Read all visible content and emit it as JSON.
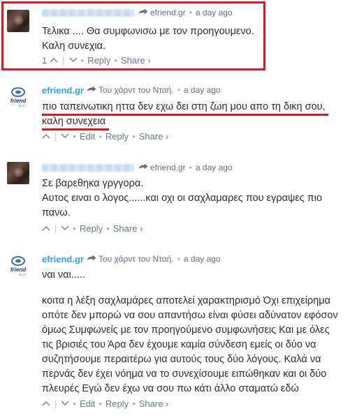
{
  "comments": [
    {
      "avatar": "avatar-photo",
      "reply_to": "efriend.gr",
      "time": "a day ago",
      "lines": [
        "Τελικα .... Θα συμφωνισω με τον προηγουμενο.",
        "Καλη συνεχια."
      ],
      "votes": "1",
      "actions": [
        "Reply",
        "Share ›"
      ]
    },
    {
      "avatar": "efriend-logo",
      "author": "efriend.gr",
      "reply_to": "Του χάρντ του Νταή.",
      "time": "a day ago",
      "lines": [
        "πιο ταπεινωτικη ηττα δεν εχω δει στη ζωη μου απο τη δικη σου,",
        "καλη συνεχεια"
      ],
      "actions": [
        "Edit",
        "Reply",
        "Share ›"
      ]
    },
    {
      "avatar": "avatar-photo",
      "reply_to": "efriend.gr",
      "time": "a day ago",
      "lines": [
        "Σε βαρεθηκα γργγορα.",
        "Αυτος ειναι ο λογος......και οχι οι σαχλαμαρες που εγραψες πιο",
        "πανω."
      ],
      "actions": [
        "Reply",
        "Share ›"
      ]
    },
    {
      "avatar": "efriend-logo",
      "author": "efriend.gr",
      "reply_to": "Του χάρντ του Νταή.",
      "time": "a day ago",
      "lines": [
        "ναι ναι.....",
        "",
        "κοιτα η λέξη σαχλαμάρες αποτελεί χαρακτηρισμό Όχι επιχείρημα οπότε δεν μπορώ να σου απαντήσω είναι φύσει αδύνατον εφόσον όμως Συμφωνείς με τον προηγούμενο συμφωνήσεις Και με όλες τις βρισιές του Άρα δεν έχουμε καμία σύνδεση εμείς οι δύο να συζητήσουμε περαιτέρω για αυτούς τους δύο λόγους. Καλά να περνάς δεν έχει νόημα να το συνεχίσουμε ειπώθηκαν και οι δύο πλευρές Εγώ δεν έχω να σου πω κάτι άλλο σταματώ εδώ"
      ],
      "actions": [
        "Edit",
        "Reply",
        "Share ›"
      ]
    }
  ],
  "colors": {
    "accent": "#2e9fff",
    "highlight": "#e8101f",
    "meta": "#656c7a"
  }
}
